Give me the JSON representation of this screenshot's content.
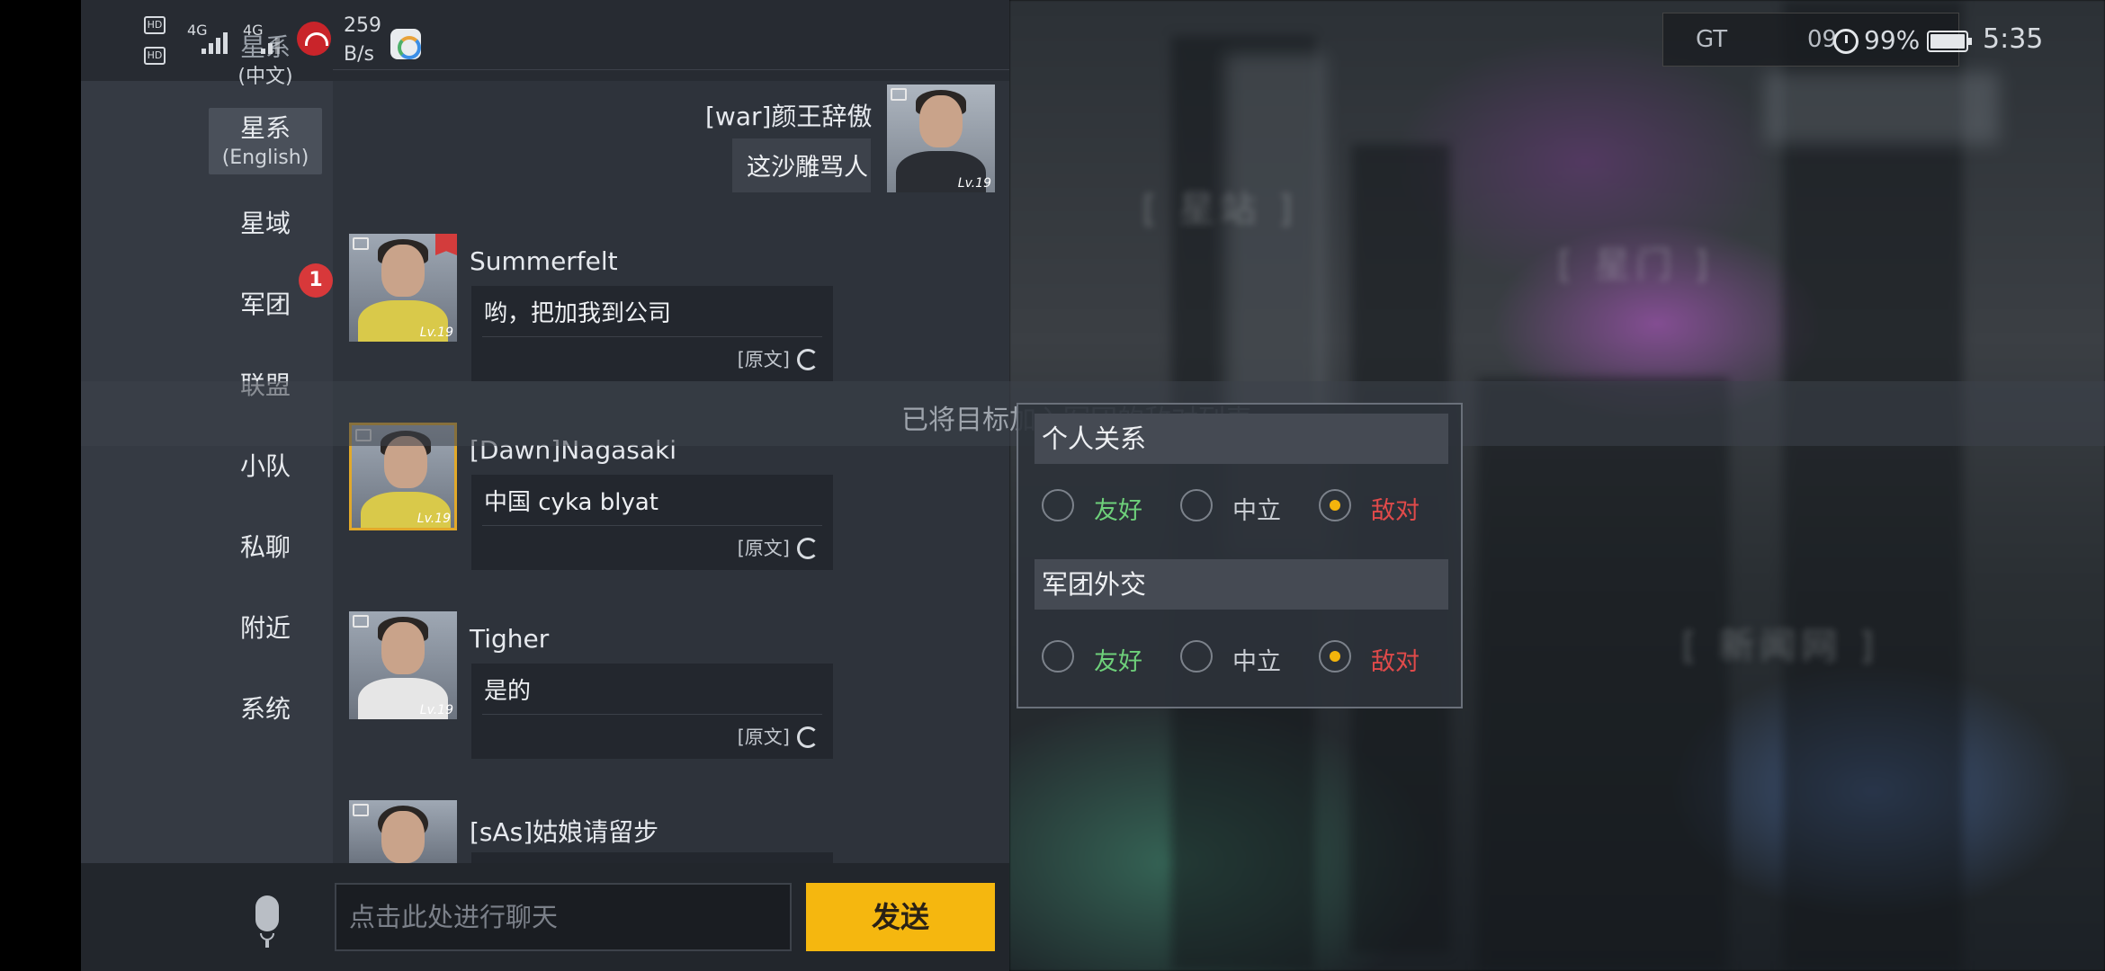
{
  "status_bar": {
    "hd1": "HD",
    "hd2": "HD",
    "net1": "4G",
    "net2": "4G",
    "speed_value": "259",
    "speed_unit": "B/s",
    "overlay_label": "GT",
    "overlay_value": "09",
    "battery": "99%",
    "time": "5:35"
  },
  "tabs": [
    {
      "label": "星系",
      "sub": "(中文)"
    },
    {
      "label": "星系",
      "sub": "(English)"
    },
    {
      "label": "星域"
    },
    {
      "label": "军团",
      "badge": "1"
    },
    {
      "label": "联盟"
    },
    {
      "label": "小队"
    },
    {
      "label": "私聊"
    },
    {
      "label": "附近"
    },
    {
      "label": "系统"
    }
  ],
  "messages": [
    {
      "name": "[war]颜王辞傲",
      "text": "这沙雕骂人",
      "level": "Lv.19"
    },
    {
      "name": "Summerfelt",
      "text": "哟，把加我到公司",
      "original_label": "[原文]",
      "level": "Lv.19"
    },
    {
      "name": "[Dawn]Nagasaki",
      "text": "中国 cyka blyat",
      "original_label": "[原文]",
      "level": "Lv.19"
    },
    {
      "name": "Tigher",
      "text": "是的",
      "original_label": "[原文]",
      "level": "Lv.19"
    },
    {
      "name": "[sAs]姑娘请留步"
    }
  ],
  "toast": "已将目标加入军团的敌对列表",
  "relation_panel": {
    "personal_title": "个人关系",
    "corp_title": "军团外交",
    "options": [
      "友好",
      "中立",
      "敌对"
    ],
    "personal_selected": "敌对",
    "corp_selected": "敌对"
  },
  "input": {
    "placeholder": "点击此处进行聊天"
  },
  "send_label": "发送",
  "background_labels": [
    "[ 星站 ]",
    "[ 星门 ]",
    "[ 新闻网 ]"
  ],
  "colors": {
    "send": "#f5b70f",
    "friendly": "#6ed07a",
    "hostile": "#e04a4a",
    "badge": "#d8383a"
  }
}
